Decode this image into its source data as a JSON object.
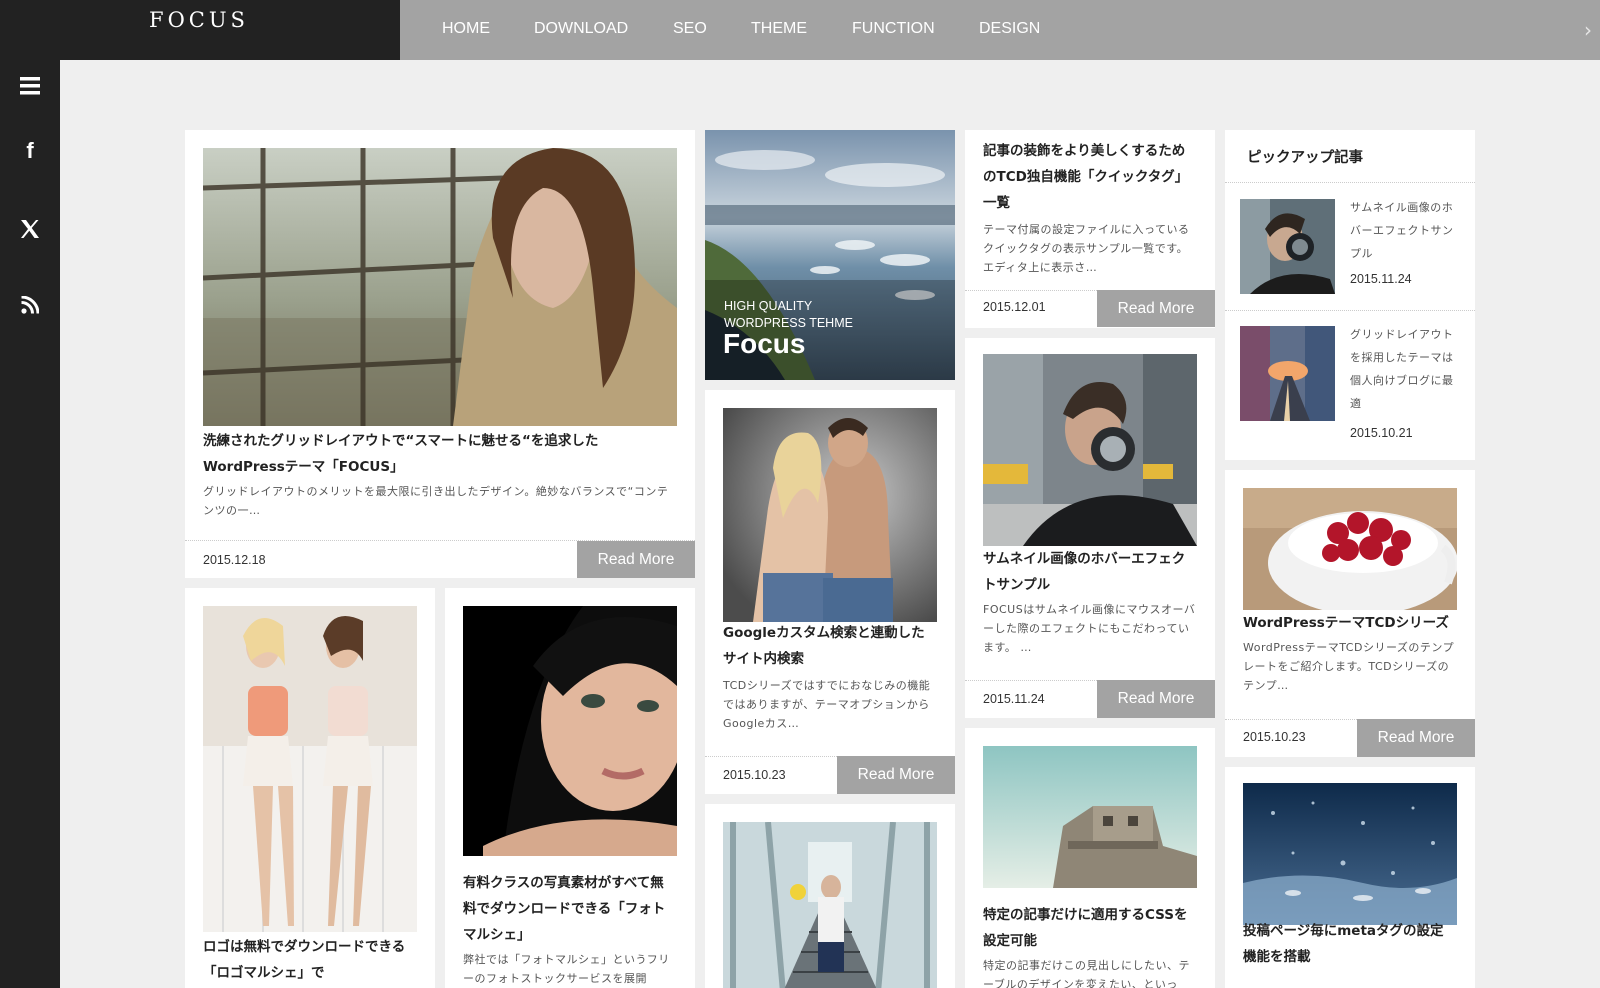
{
  "header": {
    "logo": "FOCUS",
    "nav": [
      "HOME",
      "DOWNLOAD",
      "SEO",
      "THEME",
      "FUNCTION",
      "DESIGN"
    ],
    "arrow": "›"
  },
  "sidebar": {
    "icons": [
      "menu-icon",
      "facebook-icon",
      "x-icon",
      "rss-icon"
    ],
    "menu_glyph": "≡",
    "facebook_glyph": "f",
    "x_glyph": "𝕏",
    "rss_glyph": "))"
  },
  "read_more": "Read More",
  "banner": {
    "line1": "HIGH QUALITY",
    "line2": "WORDPRESS TEHME",
    "title": "Focus"
  },
  "posts": {
    "p1": {
      "title": "洗練されたグリッドレイアウトで“スマートに魅せる“を追求したWordPressテーマ「FOCUS」",
      "excerpt": "グリッドレイアウトのメリットを最大限に引き出したデザイン。絶妙なバランスで“コンテンツの一…",
      "date": "2015.12.18"
    },
    "p2": {
      "title": "Googleカスタム検索と連動したサイト内検索",
      "excerpt": "TCDシリーズではすでにおなじみの機能ではありますが、テーマオプションからGoogleカス…",
      "date": "2015.10.23"
    },
    "p3": {
      "title": "記事の装飾をより美しくするためのTCD独自機能「クイックタグ」一覧",
      "excerpt": "テーマ付属の設定ファイルに入っているクイックタグの表示サンプル一覧です。エディタ上に表示さ…",
      "date": "2015.12.01"
    },
    "p4": {
      "title": "サムネイル画像のホバーエフェクトサンプル",
      "excerpt": "FOCUSはサムネイル画像にマウスオーバーした際のエフェクトにもこだわっています。 …",
      "date": "2015.11.24"
    },
    "p5": {
      "title": "WordPressテーマTCDシリーズ",
      "excerpt": "WordPressテーマTCDシリーズのテンプレートをご紹介します。TCDシリーズのテンプ…",
      "date": "2015.10.23"
    },
    "p6": {
      "title": "ロゴは無料でダウンロードできる「ロゴマルシェ」で",
      "excerpt": "",
      "date": ""
    },
    "p7": {
      "title": "有料クラスの写真素材がすべて無料でダウンロードできる「フォトマルシェ」",
      "excerpt": "弊社では「フォトマルシェ」というフリーのフォトストックサービスを展開",
      "date": ""
    },
    "p8": {
      "title": "特定の記事だけに適用するCSSを設定可能",
      "excerpt": "特定の記事だけこの見出しにしたい、テーブルのデザインを変えたい、といっ",
      "date": ""
    },
    "p9": {
      "title": "投稿ページ毎にmetaタグの設定機能を搭載",
      "excerpt": "",
      "date": ""
    }
  },
  "pickup": {
    "heading": "ピックアップ記事",
    "items": [
      {
        "title": "サムネイル画像のホバーエフェクトサンプル",
        "date": "2015.11.24"
      },
      {
        "title": "グリッドレイアウトを採用したテーマは個人向けブログに最適",
        "date": "2015.10.21"
      }
    ]
  }
}
